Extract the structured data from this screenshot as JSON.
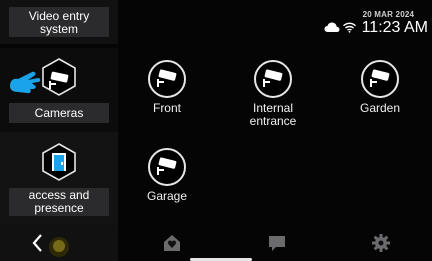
{
  "sidebar": {
    "items": [
      {
        "label": "Video entry system"
      },
      {
        "label": "Cameras"
      },
      {
        "label": "access and presence"
      }
    ]
  },
  "status": {
    "date": "20 MAR 2024",
    "time": "11:23 AM",
    "icons": [
      "cloud-icon",
      "wifi-icon"
    ]
  },
  "cameras": [
    {
      "label": "Front"
    },
    {
      "label": "Internal entrance"
    },
    {
      "label": "Garden"
    },
    {
      "label": "Garage"
    }
  ],
  "bottombar": {
    "icons": [
      "back-icon",
      "home-icon",
      "chat-icon",
      "settings-icon"
    ]
  },
  "colors": {
    "accent": "#1aa3e8",
    "panel": "#2b2b2d"
  }
}
